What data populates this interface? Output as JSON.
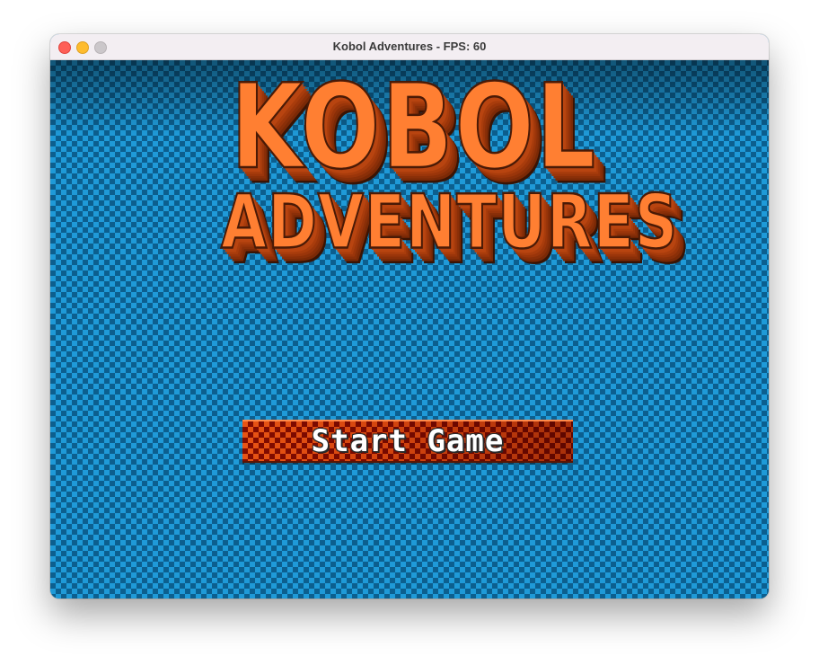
{
  "window": {
    "title": "Kobol Adventures - FPS: 60"
  },
  "logo": {
    "line1": "KOBOL",
    "line2": "ADVENTURES"
  },
  "menu": {
    "start_label": "Start Game"
  },
  "colors": {
    "background_blue": "#1f9ad8",
    "background_checker_dark": "#0c5f8f",
    "logo_orange": "#ff7f32",
    "button_red": "#c53a0c"
  },
  "icons": {
    "close": "close-dot",
    "minimize": "minimize-dot",
    "zoom": "zoom-dot"
  }
}
